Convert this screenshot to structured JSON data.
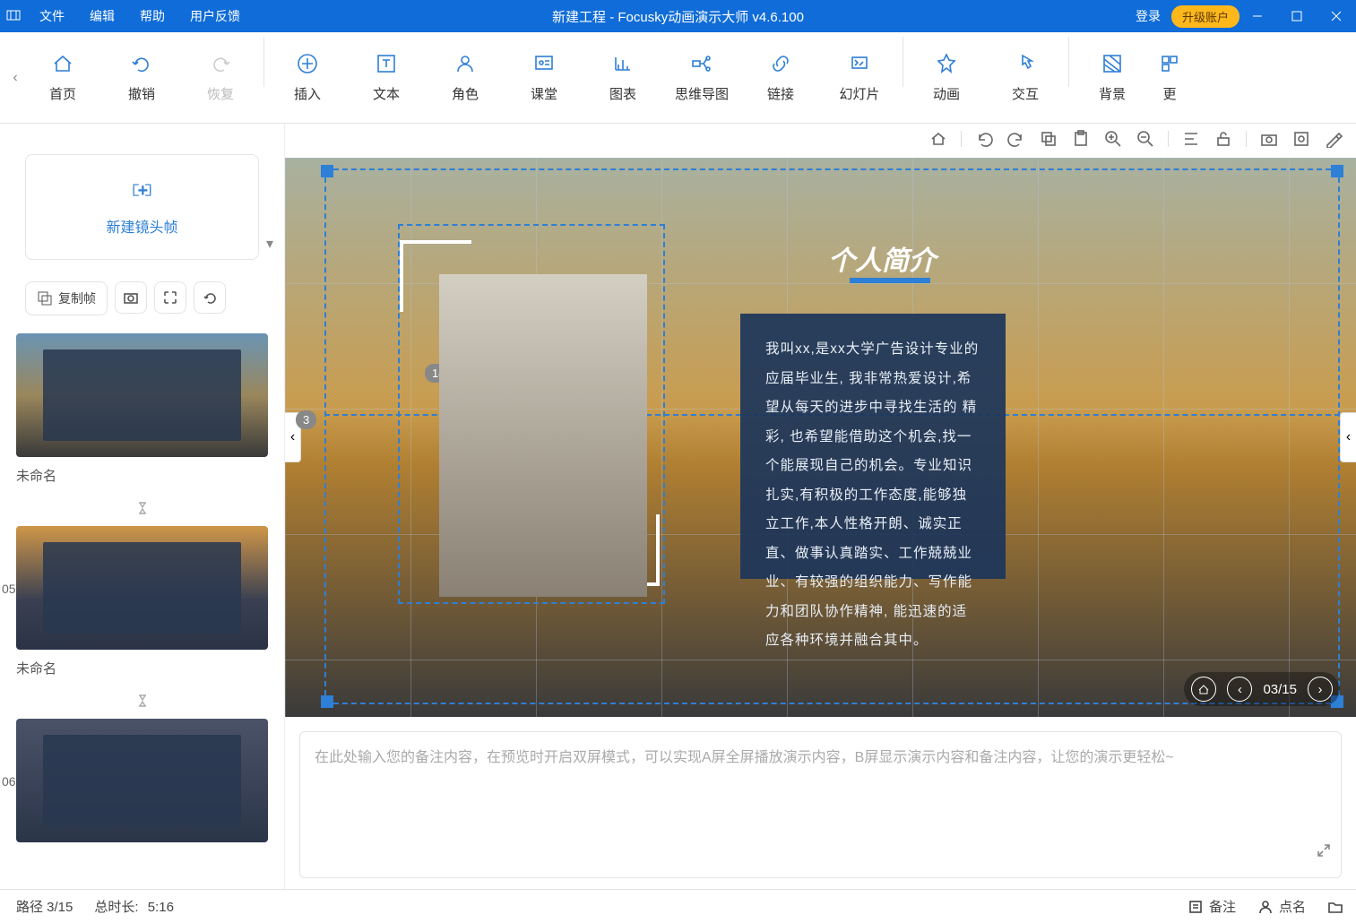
{
  "titlebar": {
    "menus": [
      "文件",
      "编辑",
      "帮助",
      "用户反馈"
    ],
    "title": "新建工程 - Focusky动画演示大师  v4.6.100",
    "login": "登录",
    "upgrade": "升级账户"
  },
  "toolbar": {
    "buttons": [
      {
        "id": "home",
        "label": "首页"
      },
      {
        "id": "undo",
        "label": "撤销"
      },
      {
        "id": "redo",
        "label": "恢复",
        "disabled": true
      },
      {
        "sep": true
      },
      {
        "id": "insert",
        "label": "插入"
      },
      {
        "id": "text",
        "label": "文本"
      },
      {
        "id": "character",
        "label": "角色"
      },
      {
        "id": "class",
        "label": "课堂"
      },
      {
        "id": "chart",
        "label": "图表"
      },
      {
        "id": "mindmap",
        "label": "思维导图"
      },
      {
        "id": "link",
        "label": "链接"
      },
      {
        "id": "slide",
        "label": "幻灯片"
      },
      {
        "sep": true
      },
      {
        "id": "animation",
        "label": "动画"
      },
      {
        "id": "interact",
        "label": "交互"
      },
      {
        "sep": true
      },
      {
        "id": "background",
        "label": "背景"
      },
      {
        "id": "more",
        "label": "更"
      }
    ]
  },
  "sidebar": {
    "new_frame": "新建镜头帧",
    "copy_frame": "复制帧",
    "thumbs": [
      {
        "num": "",
        "label": "未命名"
      },
      {
        "num": "05",
        "label": "未命名"
      },
      {
        "num": "06",
        "label": ""
      }
    ]
  },
  "canvas": {
    "badge1": "14",
    "badge2": "3",
    "title": "个人简介",
    "body": "我叫xx,是xx大学广告设计专业的应届毕业生, 我非常热爱设计,希望从每天的进步中寻找生活的 精彩, 也希望能借助这个机会,找一个能展现自己的机会。专业知识扎实,有积极的工作态度,能够独立工作,本人性格开朗、诚实正直、做事认真踏实、工作兢兢业业、有较强的组织能力、写作能力和团队协作精神, 能迅速的适应各种环境并融合其中。",
    "nav_pos": "03/15"
  },
  "notes": {
    "placeholder": "在此处输入您的备注内容，在预览时开启双屏模式，可以实现A屏全屏播放演示内容，B屏显示演示内容和备注内容，让您的演示更轻松~"
  },
  "status": {
    "path": "路径 3/15",
    "duration_label": "总时长:",
    "duration": "5:16",
    "notes_btn": "备注",
    "naming_btn": "点名"
  }
}
